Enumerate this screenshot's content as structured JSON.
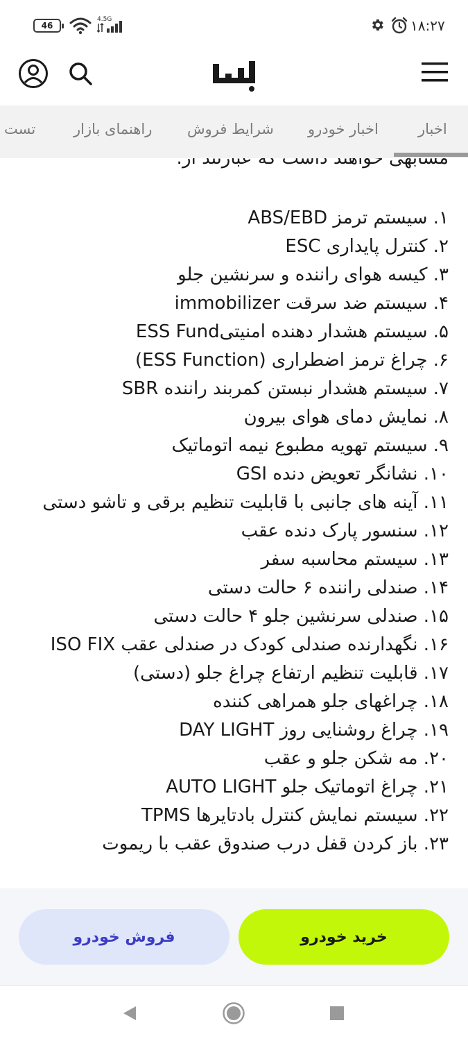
{
  "status_bar": {
    "battery": "46",
    "network_type": "4.5G",
    "time": "۱۸:۲۷",
    "icons": [
      "wifi-icon",
      "signal-icon",
      "gear-icon",
      "alarm-icon"
    ]
  },
  "header": {
    "icons": [
      "profile-icon",
      "search-icon",
      "logo",
      "menu-icon"
    ]
  },
  "tabs": [
    {
      "label": "اخبار"
    },
    {
      "label": "اخبار خودرو"
    },
    {
      "label": "شرایط فروش"
    },
    {
      "label": "راهنمای بازار"
    },
    {
      "label": "تست"
    }
  ],
  "content": {
    "cut_line": "مشابهی خواهند داشت که عبارتند از:",
    "features": [
      "۱. سیستم ترمز ABS/EBD",
      "۲. کنترل پایداری ESC",
      "۳. کیسه هوای راننده و سرنشین جلو",
      "۴. سیستم ضد سرقت immobilizer",
      "۵. سیستم هشدار دهنده امنیتیESS Fund",
      "۶. چراغ ترمز اضطراری (ESS Function)",
      "۷. سیستم هشدار نبستن کمربند راننده SBR",
      "۸. نمایش دمای هوای بیرون",
      "۹. سیستم تهویه مطبوع نیمه اتوماتیک",
      "۱۰. نشانگر تعویض دنده GSI",
      "۱۱. آینه های جانبی با قابلیت تنظیم برقی و تاشو دستی",
      "۱۲. سنسور پارک دنده عقب",
      "۱۳. سیستم محاسبه سفر",
      "۱۴. صندلی راننده ۶ حالت دستی",
      "۱۵. صندلی سرنشین جلو ۴ حالت دستی",
      "۱۶. نگهدارنده صندلی کودک در صندلی عقب ISO FIX",
      "۱۷. قابلیت تنظیم ارتفاع چراغ جلو (دستی)",
      "۱۸. چراغهای جلو همراهی کننده",
      "۱۹. چراغ روشنایی روز DAY LIGHT",
      "۲۰. مه شکن جلو و عقب",
      "۲۱. چراغ اتوماتیک جلو AUTO LIGHT",
      "۲۲. سیستم نمایش کنترل بادتایرها TPMS",
      "۲۳. باز کردن قفل درب صندوق عقب با ریموت"
    ]
  },
  "actions": {
    "buy_label": "خرید خودرو",
    "sell_label": "فروش خودرو"
  },
  "colors": {
    "buy_button": "#c3f70a",
    "sell_button": "#dfe6fa",
    "sell_text": "#3c3dc2",
    "tab_bar": "#f2f2f2"
  },
  "nav_bar": {
    "icons": [
      "back-icon",
      "home-icon",
      "recent-apps-icon"
    ]
  }
}
